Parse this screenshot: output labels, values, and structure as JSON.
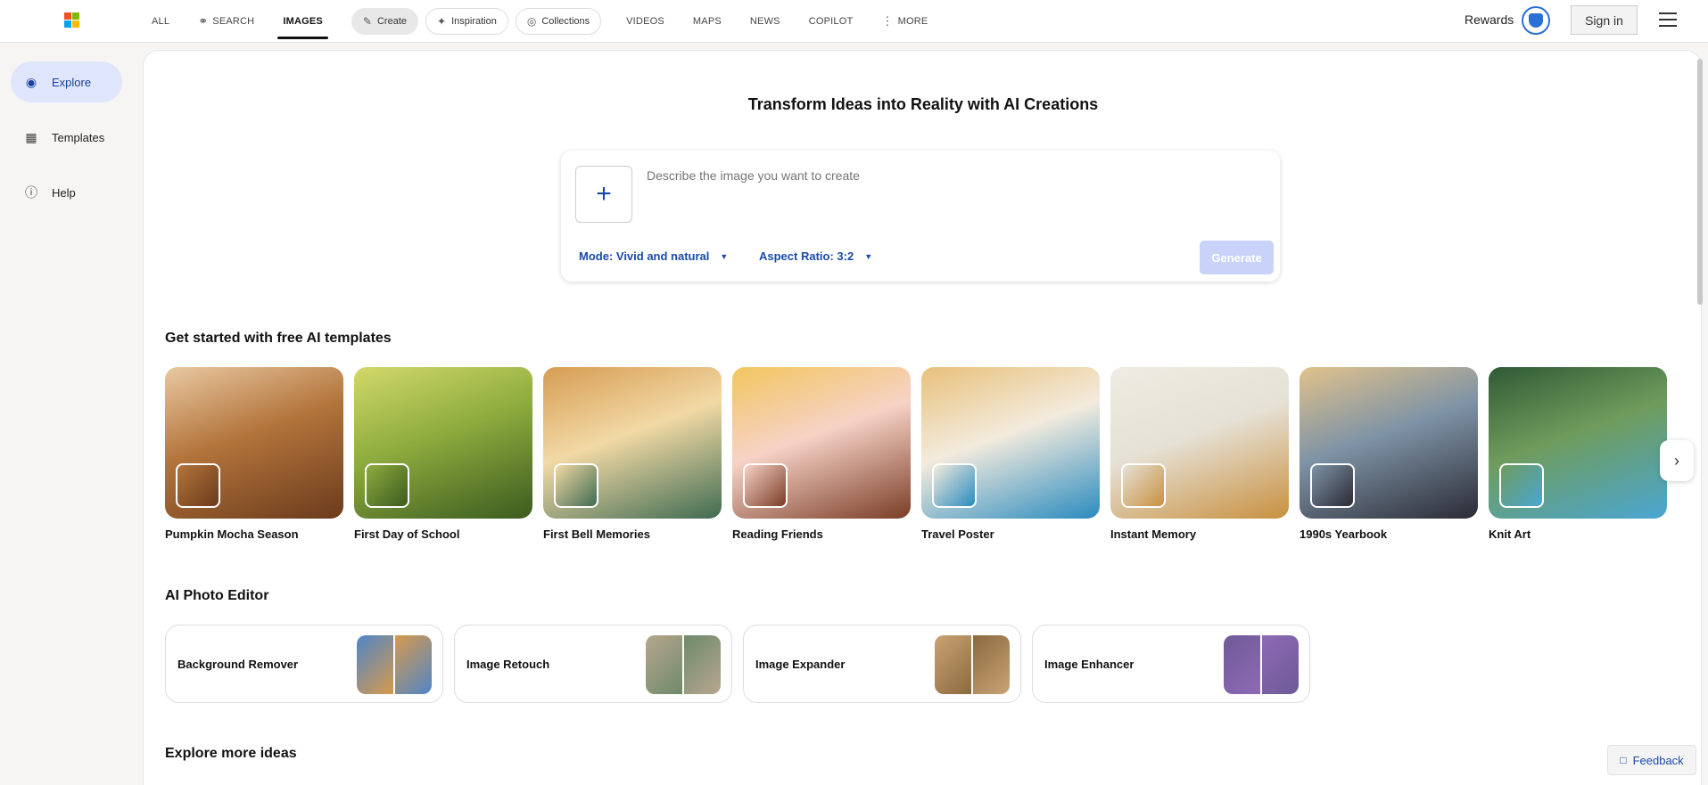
{
  "nav": {
    "items": [
      {
        "label": "ALL",
        "type": "text"
      },
      {
        "label": "SEARCH",
        "type": "text",
        "icon": "search-icon"
      },
      {
        "label": "IMAGES",
        "type": "active"
      },
      {
        "label": "Create",
        "type": "pill-filled",
        "icon": "create-icon"
      },
      {
        "label": "Inspiration",
        "type": "pill",
        "icon": "inspiration-icon"
      },
      {
        "label": "Collections",
        "type": "pill",
        "icon": "collections-icon"
      },
      {
        "label": "VIDEOS",
        "type": "text"
      },
      {
        "label": "MAPS",
        "type": "text"
      },
      {
        "label": "NEWS",
        "type": "text"
      },
      {
        "label": "COPILOT",
        "type": "text"
      },
      {
        "label": "MORE",
        "type": "text",
        "icon": "more-icon"
      }
    ],
    "rewards_label": "Rewards",
    "signin_label": "Sign in"
  },
  "sidebar": {
    "items": [
      {
        "label": "Explore",
        "icon": "explore-icon",
        "active": true
      },
      {
        "label": "Templates",
        "icon": "templates-icon",
        "active": false
      },
      {
        "label": "Help",
        "icon": "help-icon",
        "active": false
      }
    ]
  },
  "hero": {
    "title": "Transform Ideas into Reality with AI Creations",
    "placeholder": "Describe the image you want to create",
    "mode_label": "Mode: Vivid and natural",
    "aspect_label": "Aspect Ratio: 3:2",
    "generate_label": "Generate"
  },
  "templates": {
    "title": "Get started with free AI templates",
    "items": [
      {
        "label": "Pumpkin Mocha Season",
        "colors": [
          "#b3743b",
          "#6b3b1c",
          "#e9c9a2"
        ]
      },
      {
        "label": "First Day of School",
        "colors": [
          "#8eac3e",
          "#3c5b1f",
          "#d2d96a"
        ]
      },
      {
        "label": "First Bell Memories",
        "colors": [
          "#f2d9a5",
          "#3f6b52",
          "#d69c53"
        ]
      },
      {
        "label": "Reading Friends",
        "colors": [
          "#f6d2c6",
          "#7a3d26",
          "#f2c65e"
        ]
      },
      {
        "label": "Travel Poster",
        "colors": [
          "#f3ebdd",
          "#2a8bbf",
          "#e8c07a"
        ]
      },
      {
        "label": "Instant Memory",
        "colors": [
          "#e6e1d6",
          "#c8903f",
          "#f0ebe2"
        ]
      },
      {
        "label": "1990s Yearbook",
        "colors": [
          "#7e93a6",
          "#2b2b35",
          "#e2c28b"
        ]
      },
      {
        "label": "Knit Art",
        "colors": [
          "#6f9c5c",
          "#4aa6d3",
          "#2f5a35"
        ]
      }
    ],
    "next_icon": "chevron-right-icon"
  },
  "editor": {
    "title": "AI Photo Editor",
    "items": [
      {
        "label": "Background Remover",
        "colors": [
          "#4f86c6",
          "#d79a4c"
        ]
      },
      {
        "label": "Image Retouch",
        "colors": [
          "#b7a68f",
          "#6e8a6a"
        ]
      },
      {
        "label": "Image Expander",
        "colors": [
          "#c9a374",
          "#8b6a3e"
        ]
      },
      {
        "label": "Image Enhancer",
        "colors": [
          "#6e5a95",
          "#8e6ab7"
        ]
      }
    ]
  },
  "explore": {
    "title": "Explore more ideas"
  },
  "feedback_label": "Feedback",
  "colors": {
    "accent": "#1a4aa8",
    "active_bg": "#dfe6fb",
    "generate_disabled": "#c9d3fa"
  }
}
